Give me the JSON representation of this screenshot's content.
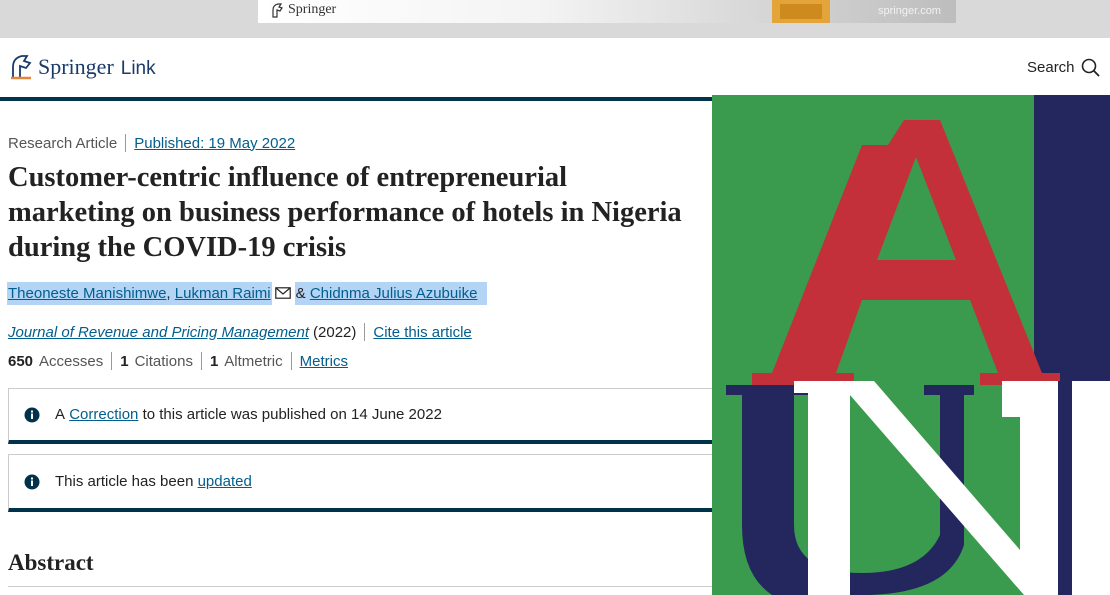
{
  "ad": {
    "logo_text": "Springer",
    "site_text": "springer.com"
  },
  "header": {
    "brand_name": "Springer",
    "brand_suffix": "Link",
    "search_label": "Search"
  },
  "article": {
    "type": "Research Article",
    "published": "Published: 19 May 2022",
    "title_lines": [
      "Customer-centric influence of entrepreneurial",
      "marketing on business performance of hotels in Nigeria",
      "during the COVID-19 crisis"
    ],
    "authors": [
      "Theoneste Manishimwe",
      "Lukman Raimi",
      "Chidnma Julius Azubuike"
    ],
    "author_sep": ",",
    "author_and": "&",
    "journal": "Journal of Revenue and Pricing Management",
    "year": "(2022)",
    "cite_label": "Cite this article",
    "metrics": {
      "accesses_value": "650",
      "accesses_label": "Accesses",
      "citations_value": "1",
      "citations_label": "Citations",
      "altmetric_value": "1",
      "altmetric_label": "Altmetric",
      "metrics_link": "Metrics"
    },
    "notices": {
      "correction_prefix": "A",
      "correction_link": "Correction",
      "correction_suffix": "to this article was published on 14 June 2022",
      "updated_prefix": "This article has been",
      "updated_link": "updated"
    },
    "abstract_heading": "Abstract"
  },
  "colors": {
    "navy": "#01324b",
    "link": "#025e8d",
    "highlight": "#b4d4f5",
    "cover_green": "#3a9a4e",
    "cover_red": "#c4303a",
    "cover_blue": "#24265e"
  },
  "icons": {
    "brand": "springer-horse-icon",
    "search": "search-icon",
    "mail": "mail-icon",
    "info": "info-icon"
  }
}
